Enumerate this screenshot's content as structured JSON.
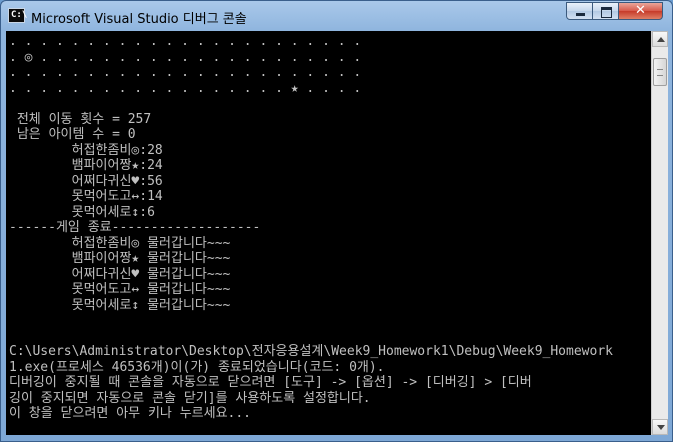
{
  "window": {
    "title": "Microsoft Visual Studio 디버그 콘솔",
    "icon": "console-icon",
    "icon_glyph": "C:\\"
  },
  "controls": {
    "minimize_icon": "minimize-icon",
    "maximize_icon": "maximize-icon",
    "close_icon": "close-icon",
    "close_glyph": "✕"
  },
  "console": {
    "lines": [
      ". . . . . . . . . . . . . . . . . . . . . . .",
      ". ◎ . . . . . . . . . . . . . . . . . . . . .",
      ". . . . . . . . . . . . . . . . . . . . . . .",
      ". . . . . . . . . . . . . . . . . . ★ . . . .",
      "",
      " 전체 이동 횟수 = 257",
      " 남은 아이템 수 = 0",
      "        허접한좀비◎:28",
      "        뱀파이어짱★:24",
      "        어쩌다귀신♥:56",
      "        못먹어도고↔:14",
      "        못먹어세로↕:6",
      "------게임 종료-------------------",
      "        허접한좀비◎ 물러갑니다~~~",
      "        뱀파이어짱★ 물러갑니다~~~",
      "        어쩌다귀신♥ 물러갑니다~~~",
      "        못먹어도고↔ 물러갑니다~~~",
      "        못먹어세로↕ 물러갑니다~~~",
      "",
      "",
      "C:\\Users\\Administrator\\Desktop\\전자응용설계\\Week9_Homework1\\Debug\\Week9_Homework",
      "1.exe(프로세스 46536개)이(가) 종료되었습니다(코드: 0개).",
      "디버깅이 중지될 때 콘솔을 자동으로 닫으려면 [도구] -> [옵션] -> [디버깅] > [디버",
      "깅이 중지되면 자동으로 콘솔 닫기]를 사용하도록 설정합니다.",
      "이 창을 닫으려면 아무 키나 누르세요..."
    ]
  },
  "scrollbar": {
    "up_icon": "scroll-up-arrow-icon",
    "down_icon": "scroll-down-arrow-icon"
  }
}
